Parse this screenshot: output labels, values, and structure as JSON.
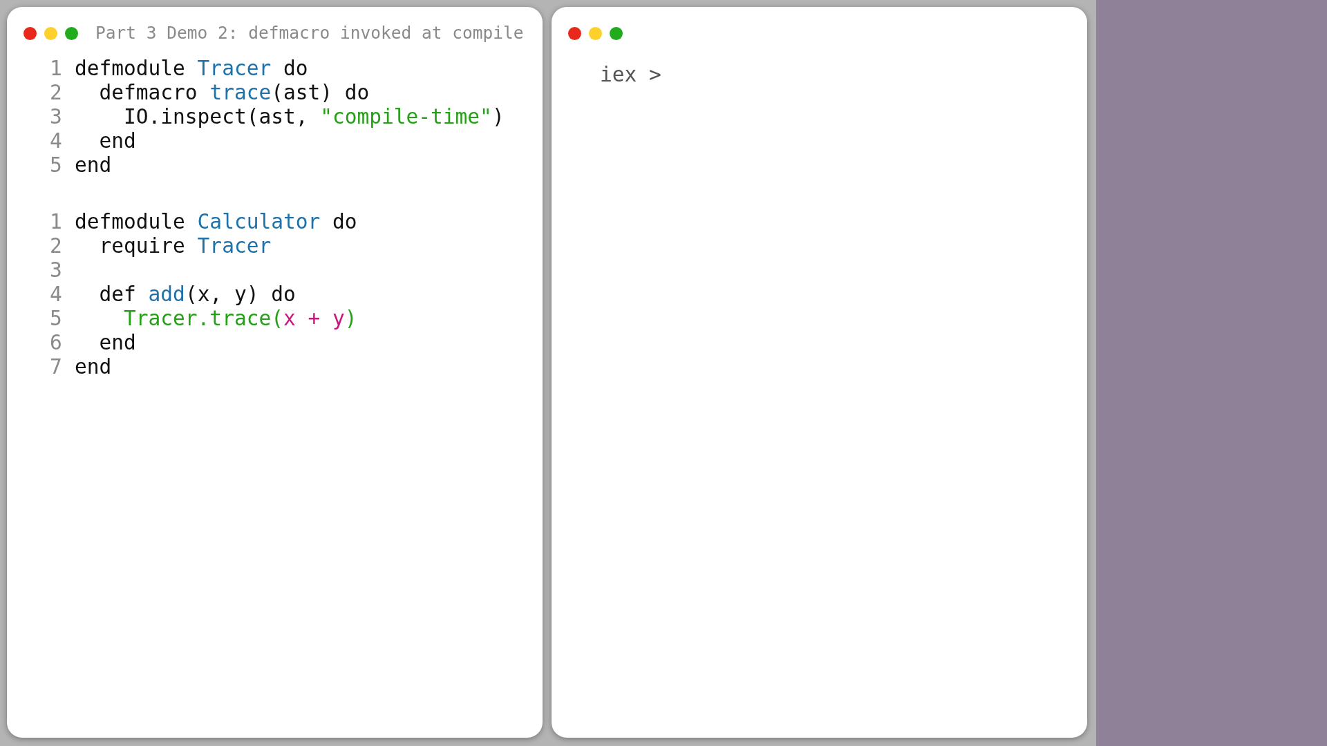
{
  "editor": {
    "title": "Part 3 Demo 2: defmacro invoked at compile",
    "code_blocks": [
      {
        "lines": [
          {
            "number": "1",
            "tokens": [
              {
                "text": "defmodule ",
                "kind": "plain"
              },
              {
                "text": "Tracer",
                "kind": "name"
              },
              {
                "text": " do",
                "kind": "plain"
              }
            ]
          },
          {
            "number": "2",
            "tokens": [
              {
                "text": "  defmacro ",
                "kind": "plain"
              },
              {
                "text": "trace",
                "kind": "name"
              },
              {
                "text": "(ast) do",
                "kind": "plain"
              }
            ]
          },
          {
            "number": "3",
            "tokens": [
              {
                "text": "    IO.inspect(ast, ",
                "kind": "plain"
              },
              {
                "text": "\"compile-time\"",
                "kind": "string"
              },
              {
                "text": ")",
                "kind": "plain"
              }
            ]
          },
          {
            "number": "4",
            "tokens": [
              {
                "text": "  end",
                "kind": "plain"
              }
            ]
          },
          {
            "number": "5",
            "tokens": [
              {
                "text": "end",
                "kind": "plain"
              }
            ]
          }
        ]
      },
      {
        "lines": [
          {
            "number": "1",
            "tokens": [
              {
                "text": "defmodule ",
                "kind": "plain"
              },
              {
                "text": "Calculator",
                "kind": "name"
              },
              {
                "text": " do",
                "kind": "plain"
              }
            ]
          },
          {
            "number": "2",
            "tokens": [
              {
                "text": "  require ",
                "kind": "plain"
              },
              {
                "text": "Tracer",
                "kind": "name"
              }
            ]
          },
          {
            "number": "3"
          },
          {
            "number": "4",
            "tokens": [
              {
                "text": "  def ",
                "kind": "plain"
              },
              {
                "text": "add",
                "kind": "name"
              },
              {
                "text": "(x, y) do",
                "kind": "plain"
              }
            ]
          },
          {
            "number": "5",
            "tokens": [
              {
                "text": "    Tracer.trace(",
                "kind": "string"
              },
              {
                "text": "x + y",
                "kind": "variable"
              },
              {
                "text": ")",
                "kind": "string"
              }
            ]
          },
          {
            "number": "6",
            "tokens": [
              {
                "text": "  end",
                "kind": "plain"
              }
            ]
          },
          {
            "number": "7",
            "tokens": [
              {
                "text": "end",
                "kind": "plain"
              }
            ]
          }
        ]
      }
    ]
  },
  "terminal": {
    "prompt": "iex >"
  }
}
